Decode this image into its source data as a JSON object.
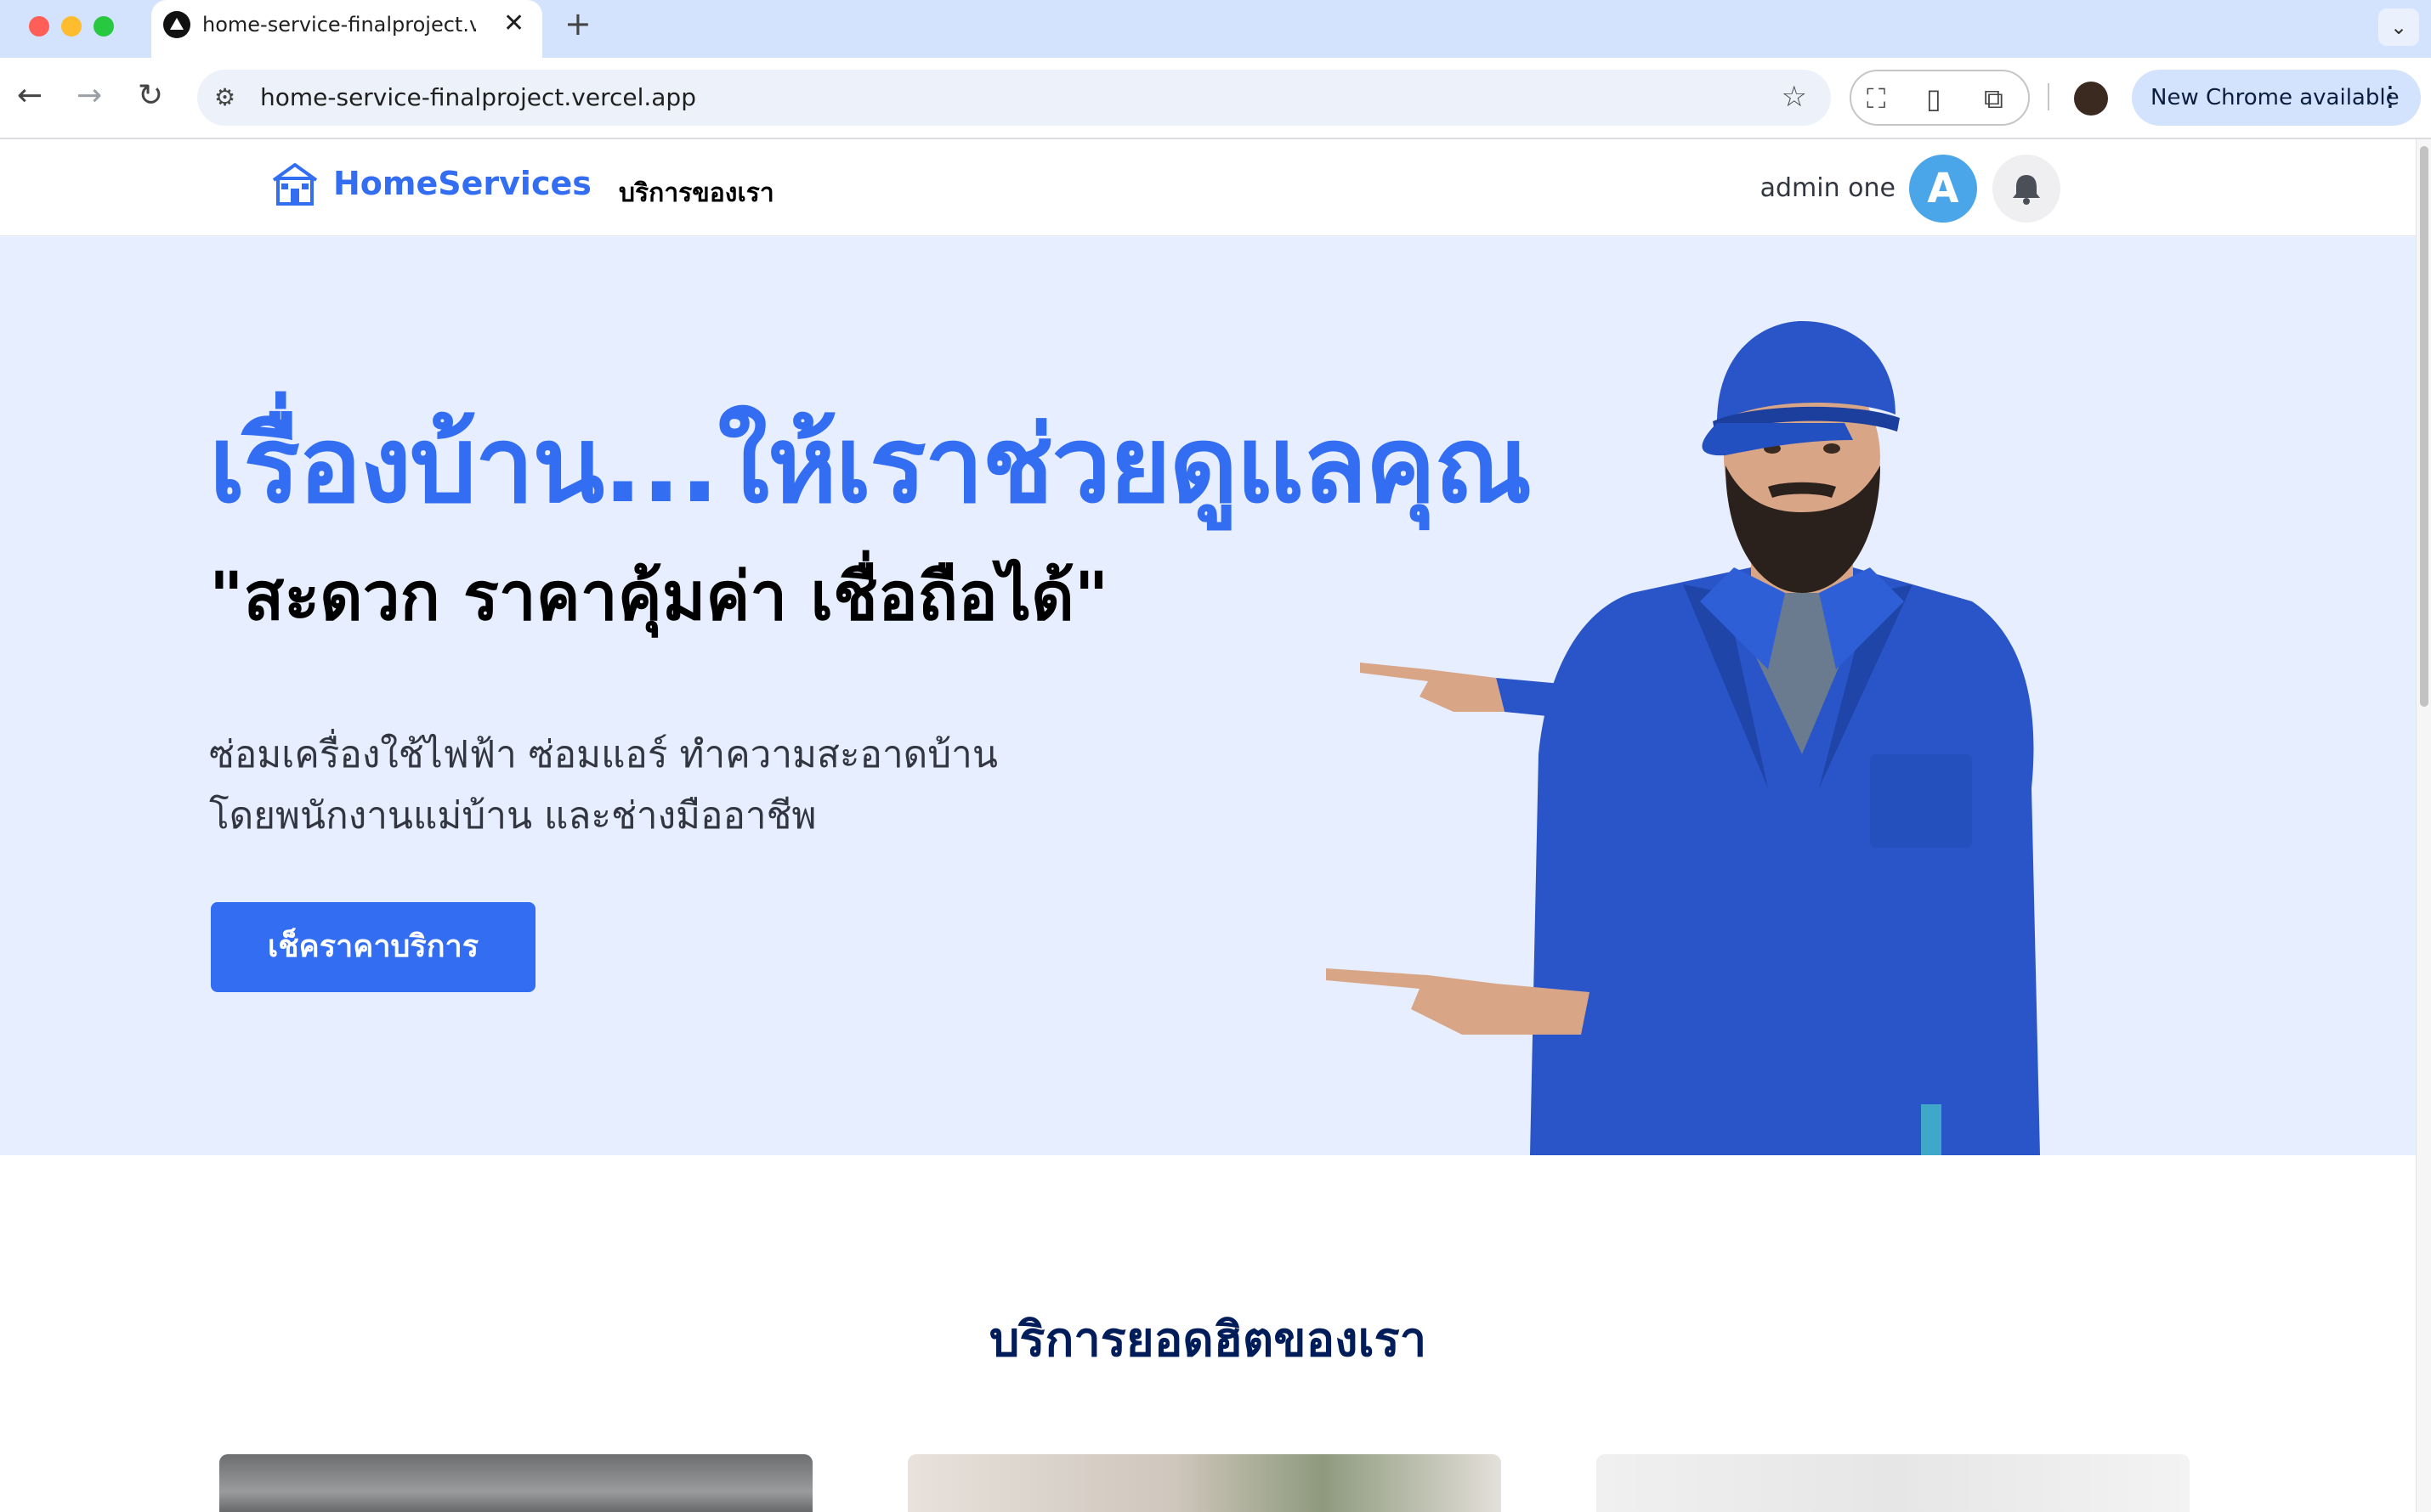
{
  "browser": {
    "tab_title": "home-service-finalproject.vercel.app",
    "url": "home-service-finalproject.vercel.app",
    "update_label": "New Chrome available"
  },
  "site": {
    "logo_text": "HomeServices",
    "nav_services": "บริการของเรา",
    "user_name": "admin one",
    "avatar_letter": "A"
  },
  "hero": {
    "title": "เรื่องบ้าน...ให้เราช่วยดูแลคุณ",
    "tagline": "\"สะดวก ราคาคุ้มค่า เชื่อถือได้\"",
    "desc_line1": "ซ่อมเครื่องใช้ไฟฟ้า ซ่อมแอร์ ทำความสะอาดบ้าน",
    "desc_line2": "โดยพนักงานแม่บ้าน และช่างมืออาชีพ",
    "cta_label": "เช็คราคาบริการ"
  },
  "popular": {
    "title": "บริการยอดฮิตของเรา"
  },
  "colors": {
    "brand_blue": "#336df2",
    "hero_bg": "#e7eeff",
    "heading_navy": "#001c59"
  }
}
